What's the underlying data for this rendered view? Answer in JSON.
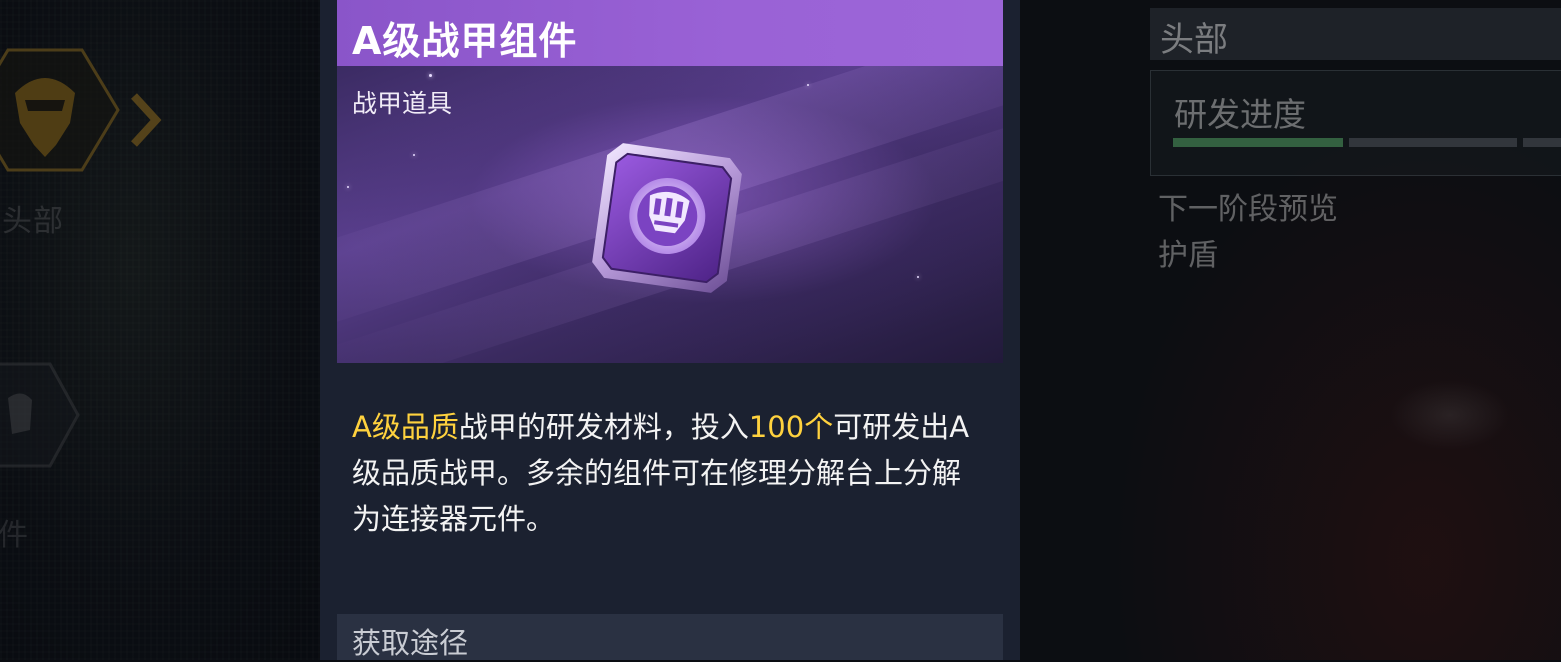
{
  "left_nav": {
    "head_label": "头部",
    "second_label": "件"
  },
  "item": {
    "title": "A级战甲组件",
    "category": "战甲道具",
    "icon": "armor-component-icon",
    "description": {
      "part1_highlight": "A级品质",
      "part2": "战甲的研发材料，投入",
      "part3_highlight": "100个",
      "part4": "可研发出A级品质战甲。多余的组件可在修理分解台上分解为连接器元件。"
    },
    "acquisition_label": "获取途径"
  },
  "right_panel": {
    "title": "头部",
    "progress_label": "研发进度",
    "progress_segments_filled": 1,
    "progress_segments_total": 3,
    "next_stage_label": "下一阶段预览",
    "next_stage_item": "护盾"
  },
  "colors": {
    "title_bar": "#9a62d6",
    "highlight": "#ffd23e",
    "panel": "#1b2130",
    "progress_filled": "#3f7a4e"
  }
}
